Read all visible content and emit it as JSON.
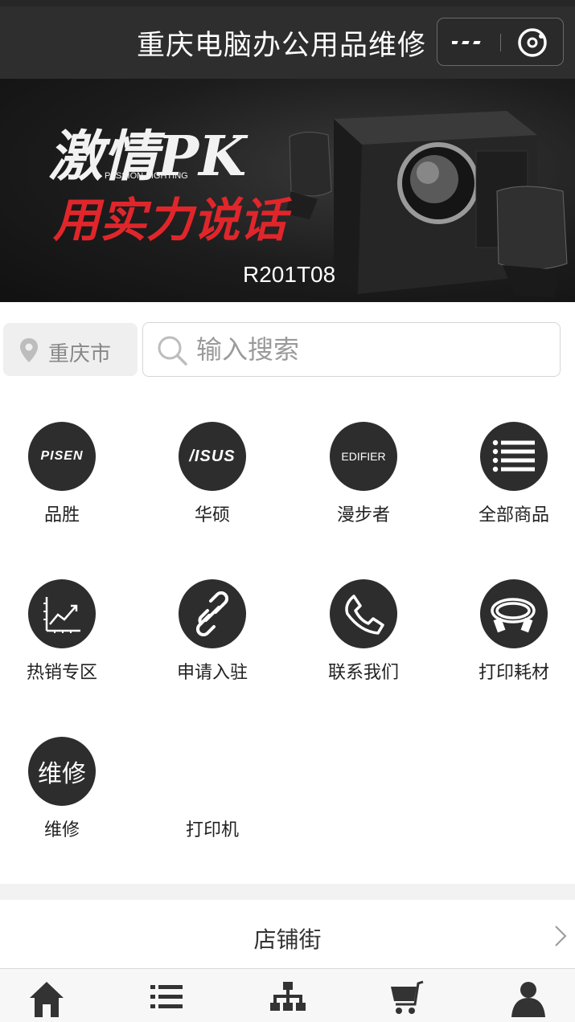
{
  "header": {
    "title": "重庆电脑办公用品维修"
  },
  "banner": {
    "slogan_top": "激情PK",
    "slogan_sub": "PASSION FIGHTING",
    "slogan_bottom": "用实力说话",
    "model": "R201T08"
  },
  "location": {
    "city": "重庆市"
  },
  "search": {
    "placeholder": "输入搜索"
  },
  "categories": [
    {
      "label": "品胜",
      "icon": "pisen-logo",
      "brand": "PISEN"
    },
    {
      "label": "华硕",
      "icon": "asus-logo",
      "brand": "/ISUS"
    },
    {
      "label": "漫步者",
      "icon": "edifier-logo",
      "brand": "EDIFIER"
    },
    {
      "label": "全部商品",
      "icon": "list-icon"
    },
    {
      "label": "热销专区",
      "icon": "trend-chart-icon"
    },
    {
      "label": "申请入驻",
      "icon": "link-icon"
    },
    {
      "label": "联系我们",
      "icon": "phone-icon"
    },
    {
      "label": "打印耗材",
      "icon": "cable-icon"
    },
    {
      "label": "维修",
      "icon": "repair-text-icon",
      "icon_text": "维修"
    },
    {
      "label": "打印机",
      "icon": ""
    }
  ],
  "shop_street": {
    "title": "店铺街"
  },
  "tabbar": {
    "items": [
      {
        "icon": "home-icon"
      },
      {
        "icon": "list-icon"
      },
      {
        "icon": "category-tree-icon"
      },
      {
        "icon": "cart-icon"
      },
      {
        "icon": "user-icon"
      }
    ]
  },
  "colors": {
    "header_bg": "#2e2e2e",
    "icon_circle": "#2d2d2d",
    "slogan_red": "#e0262b"
  }
}
